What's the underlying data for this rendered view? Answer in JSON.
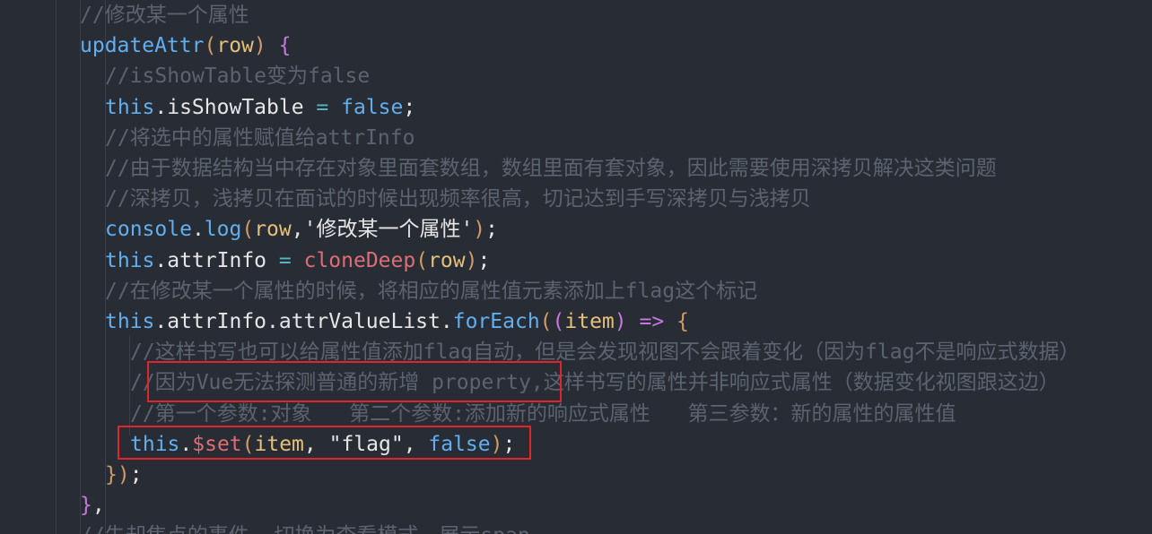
{
  "code": {
    "lines": [
      {
        "indent": 0,
        "tokens": [
          {
            "t": "//修改某一个属性",
            "c": "c-comment"
          }
        ]
      },
      {
        "indent": 0,
        "tokens": [
          {
            "t": "updateAttr",
            "c": "c-fn"
          },
          {
            "t": "(",
            "c": "c-bracket"
          },
          {
            "t": "row",
            "c": "c-param"
          },
          {
            "t": ")",
            "c": "c-bracket"
          },
          {
            "t": " ",
            "c": "c-punc"
          },
          {
            "t": "{",
            "c": "c-bracket2"
          }
        ]
      },
      {
        "indent": 1,
        "tokens": [
          {
            "t": "//isShowTable变为false",
            "c": "c-comment"
          }
        ]
      },
      {
        "indent": 1,
        "tokens": [
          {
            "t": "this",
            "c": "c-this"
          },
          {
            "t": ".isShowTable ",
            "c": "c-prop"
          },
          {
            "t": "=",
            "c": "c-op"
          },
          {
            "t": " ",
            "c": "c-punc"
          },
          {
            "t": "false",
            "c": "c-bool"
          },
          {
            "t": ";",
            "c": "c-prop"
          }
        ]
      },
      {
        "indent": 1,
        "tokens": [
          {
            "t": "//将选中的属性赋值给attrInfo",
            "c": "c-comment"
          }
        ]
      },
      {
        "indent": 1,
        "tokens": [
          {
            "t": "//由于数据结构当中存在对象里面套数组，数组里面有套对象，因此需要使用深拷贝解决这类问题",
            "c": "c-comment"
          }
        ]
      },
      {
        "indent": 1,
        "tokens": [
          {
            "t": "//深拷贝，浅拷贝在面试的时候出现频率很高，切记达到手写深拷贝与浅拷贝",
            "c": "c-comment"
          }
        ]
      },
      {
        "indent": 1,
        "tokens": [
          {
            "t": "console",
            "c": "c-fn"
          },
          {
            "t": ".",
            "c": "c-prop"
          },
          {
            "t": "log",
            "c": "c-fn"
          },
          {
            "t": "(",
            "c": "c-bracket"
          },
          {
            "t": "row",
            "c": "c-param"
          },
          {
            "t": ",'修改某一个属性'",
            "c": "c-str"
          },
          {
            "t": ")",
            "c": "c-bracket"
          },
          {
            "t": ";",
            "c": "c-prop"
          }
        ]
      },
      {
        "indent": 1,
        "tokens": [
          {
            "t": "this",
            "c": "c-this"
          },
          {
            "t": ".attrInfo ",
            "c": "c-prop"
          },
          {
            "t": "=",
            "c": "c-op"
          },
          {
            "t": " ",
            "c": "c-punc"
          },
          {
            "t": "cloneDeep",
            "c": "c-set"
          },
          {
            "t": "(",
            "c": "c-bracket"
          },
          {
            "t": "row",
            "c": "c-param"
          },
          {
            "t": ")",
            "c": "c-bracket"
          },
          {
            "t": ";",
            "c": "c-prop"
          }
        ]
      },
      {
        "indent": 1,
        "tokens": [
          {
            "t": "//在修改某一个属性的时候，将相应的属性值元素添加上flag这个标记",
            "c": "c-comment"
          }
        ]
      },
      {
        "indent": 1,
        "tokens": [
          {
            "t": "this",
            "c": "c-this"
          },
          {
            "t": ".attrInfo.attrValueList.",
            "c": "c-prop"
          },
          {
            "t": "forEach",
            "c": "c-fn"
          },
          {
            "t": "(",
            "c": "c-bracket"
          },
          {
            "t": "(",
            "c": "c-bracket2"
          },
          {
            "t": "item",
            "c": "c-param"
          },
          {
            "t": ")",
            "c": "c-bracket2"
          },
          {
            "t": " ",
            "c": "c-punc"
          },
          {
            "t": "=>",
            "c": "c-kw"
          },
          {
            "t": " ",
            "c": "c-punc"
          },
          {
            "t": "{",
            "c": "c-bracket"
          }
        ]
      },
      {
        "indent": 2,
        "tokens": [
          {
            "t": "//这样书写也可以给属性值添加flag自动，但是会发现视图不会跟着变化（因为flag不是响应式数据）",
            "c": "c-comment"
          }
        ]
      },
      {
        "indent": 2,
        "tokens": [
          {
            "t": "//因为Vue无法探测普通的新增 property,这样书写的属性并非响应式属性（数据变化视图跟这边）",
            "c": "c-comment"
          }
        ]
      },
      {
        "indent": 2,
        "tokens": [
          {
            "t": "//第一个参数:对象   第二个参数:添加新的响应式属性   第三参数：新的属性的属性值",
            "c": "c-comment"
          }
        ]
      },
      {
        "indent": 2,
        "tokens": [
          {
            "t": "this",
            "c": "c-this"
          },
          {
            "t": ".",
            "c": "c-prop"
          },
          {
            "t": "$set",
            "c": "c-set"
          },
          {
            "t": "(",
            "c": "c-bracket"
          },
          {
            "t": "item",
            "c": "c-param"
          },
          {
            "t": ", ",
            "c": "c-prop"
          },
          {
            "t": "\"flag\"",
            "c": "c-str"
          },
          {
            "t": ", ",
            "c": "c-prop"
          },
          {
            "t": "false",
            "c": "c-bool"
          },
          {
            "t": ")",
            "c": "c-bracket"
          },
          {
            "t": ";",
            "c": "c-prop"
          }
        ]
      },
      {
        "indent": 1,
        "tokens": [
          {
            "t": "}",
            "c": "c-bracket"
          },
          {
            "t": ")",
            "c": "c-bracket"
          },
          {
            "t": ";",
            "c": "c-prop"
          }
        ]
      },
      {
        "indent": 0,
        "tokens": [
          {
            "t": "}",
            "c": "c-bracket2"
          },
          {
            "t": ",",
            "c": "c-prop"
          }
        ]
      },
      {
        "indent": 0,
        "tokens": [
          {
            "t": "//失却焦点的事件——切换为查看模式，展示span",
            "c": "c-comment"
          }
        ]
      }
    ]
  },
  "colors": {
    "background": "#282c34",
    "highlight_box": "#e3242b"
  }
}
